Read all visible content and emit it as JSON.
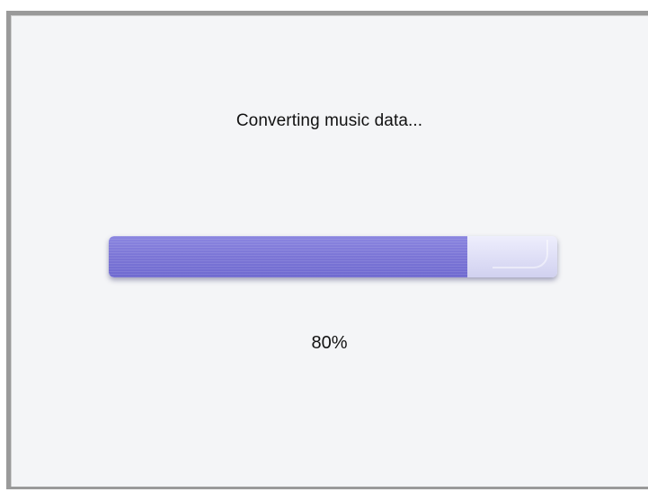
{
  "dialog": {
    "status_text": "Converting music data...",
    "progress": {
      "percent_label": "80%",
      "fraction": 0.8
    }
  },
  "colors": {
    "fill": "#7b75d6",
    "track": "#dedef6",
    "background": "#f4f5f7"
  }
}
